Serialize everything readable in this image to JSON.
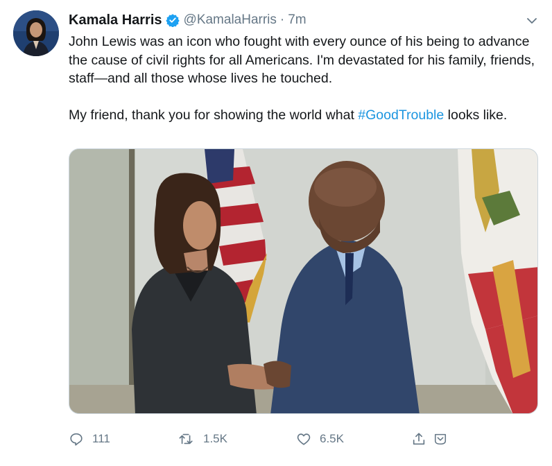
{
  "author": {
    "name": "Kamala Harris",
    "handle": "@KamalaHarris",
    "separator": "·",
    "time": "7m",
    "verified": true
  },
  "tweet": {
    "paragraph1": "John Lewis was an icon who fought with every ounce of his being to advance the cause of civil rights for all Americans. I'm devastated for his family, friends, staff—and all those whose lives he touched.",
    "paragraph2_before": "My friend, thank you for showing the world what ",
    "hashtag": "#GoodTrouble",
    "paragraph2_after": " looks like."
  },
  "actions": {
    "reply_count": "111",
    "retweet_count": "1.5K",
    "like_count": "6.5K"
  },
  "icons": {
    "verified": "verified-badge-icon",
    "caret": "chevron-down-icon",
    "reply": "reply-icon",
    "retweet": "retweet-icon",
    "like": "heart-icon",
    "share": "share-icon",
    "extra": "bookmark-icon"
  },
  "colors": {
    "link": "#1b95e0",
    "muted": "#657786",
    "text": "#14171a",
    "border": "#ccd6dd"
  }
}
